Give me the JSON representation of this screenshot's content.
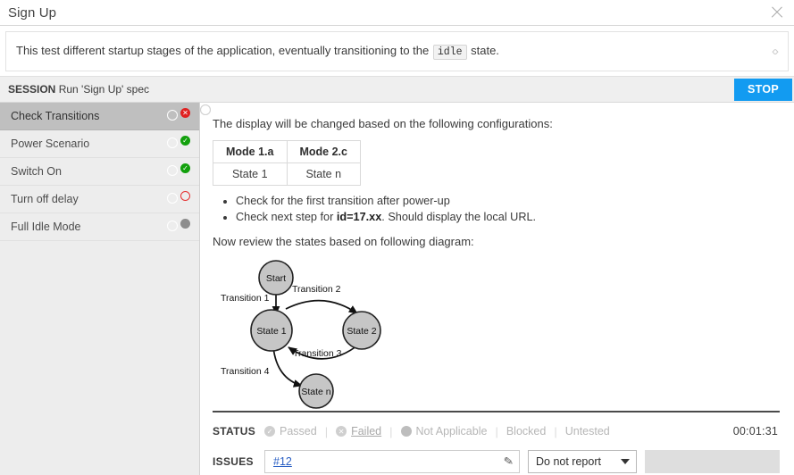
{
  "window": {
    "title": "Sign Up",
    "close_icon": "close-icon"
  },
  "description": {
    "text_before": "This test different startup stages of the application, eventually transitioning to the",
    "code": "idle",
    "text_after": "state.",
    "code_toggle_icon": "‹›"
  },
  "session": {
    "label": "SESSION",
    "name": "Run 'Sign Up' spec",
    "stop_label": "STOP"
  },
  "sidebar": {
    "steps": [
      {
        "label": "Check Transitions",
        "status": "failed",
        "selected": true
      },
      {
        "label": "Power Scenario",
        "status": "passed",
        "selected": false
      },
      {
        "label": "Switch On",
        "status": "passed",
        "selected": false
      },
      {
        "label": "Turn off delay",
        "status": "blocked",
        "selected": false
      },
      {
        "label": "Full Idle Mode",
        "status": "untested",
        "selected": false
      }
    ],
    "badge_glyphs": {
      "failed": "✕",
      "passed": "✓",
      "blocked": "",
      "untested": ""
    }
  },
  "content": {
    "intro": "The display will be changed based on the following configurations:",
    "table": {
      "headers": [
        "Mode 1.a",
        "Mode 2.c"
      ],
      "rows": [
        [
          "State 1",
          "State n"
        ]
      ]
    },
    "bullets": [
      {
        "text_before": "Check for the first transition after power-up",
        "bold": "",
        "text_after": ""
      },
      {
        "text_before": "Check next step for ",
        "bold": "id=17.xx",
        "text_after": ". Should display the local URL."
      }
    ],
    "diagram_intro": "Now review the states based on following diagram:",
    "diagram": {
      "nodes": [
        {
          "id": "start",
          "label": "Start"
        },
        {
          "id": "state1",
          "label": "State 1"
        },
        {
          "id": "state2",
          "label": "State 2"
        },
        {
          "id": "staten",
          "label": "State n"
        }
      ],
      "edges": [
        {
          "label": "Transition 1",
          "from": "start",
          "to": "state1"
        },
        {
          "label": "Transition 2",
          "from": "state1",
          "to": "state2"
        },
        {
          "label": "Transition 3",
          "from": "state2",
          "to": "state1"
        },
        {
          "label": "Transition 4",
          "from": "state1",
          "to": "staten"
        }
      ],
      "node_fill": "#c6c6c6",
      "node_stroke": "#222222"
    }
  },
  "footer": {
    "status_label": "STATUS",
    "status_options": [
      {
        "label": "Passed",
        "mark": "fill",
        "glyph": "✓",
        "selected": false
      },
      {
        "label": "Failed",
        "mark": "fill",
        "glyph": "✕",
        "selected": true
      },
      {
        "label": "Not Applicable",
        "mark": "solid",
        "glyph": "",
        "selected": false
      },
      {
        "label": "Blocked",
        "mark": "ring",
        "glyph": "",
        "selected": false
      },
      {
        "label": "Untested",
        "mark": "ring",
        "glyph": "",
        "selected": false
      }
    ],
    "timer": "00:01:31",
    "issues_label": "ISSUES",
    "issue_value": "#12",
    "pencil_icon": "✎",
    "report_select_value": "Do not report"
  },
  "colors": {
    "accent_blue": "#129bf1",
    "link_blue": "#2a5fc4",
    "status_failed": "#e02020",
    "status_passed": "#12a00c",
    "status_blocked": "#e53131",
    "status_untested": "#8d8d8d",
    "sidebar_bg": "#ededed",
    "sidebar_selected": "#bfbfbf"
  }
}
